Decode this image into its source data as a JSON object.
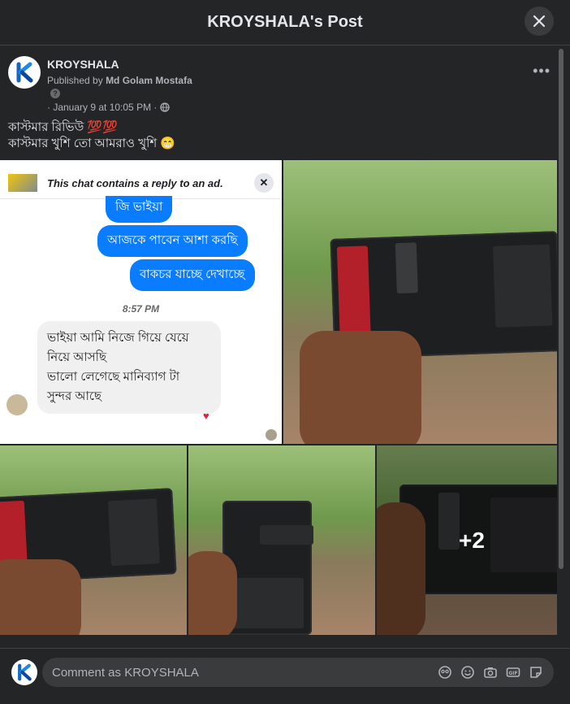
{
  "header": {
    "title": "KROYSHALA's Post"
  },
  "post": {
    "page_name": "KROYSHALA",
    "published_prefix": "Published by",
    "published_by": "Md Golam Mostafa",
    "date": "· January 9 at 10:05 PM ·",
    "caption_line1": "কাস্টমার রিভিউ 💯💯",
    "caption_line2": "কাস্টমার খুশি তো আমরাও খুশি 😁"
  },
  "chat_screenshot": {
    "banner_text": "This chat contains a reply to an ad.",
    "partial_bubble": "জি ভাইয়া",
    "msg_out_1": "আজকে পাবেন আশা করছি",
    "msg_out_2": "বাকচর যাচ্ছে দেখাচ্ছে",
    "time": "8:57 PM",
    "msg_in_line1": "ভাইয়া আমি নিজে গিয়ে যেয়ে",
    "msg_in_line2": "নিয়ে আসছি",
    "msg_in_line3": "ভালো লেগেছে মানিব্যাগ টা",
    "msg_in_line4": "সুন্দর আছে"
  },
  "photos": {
    "more_count": "+2"
  },
  "comment": {
    "placeholder": "Comment as KROYSHALA"
  },
  "colors": {
    "brand": "#1877f2",
    "bg": "#242526",
    "bubble_out": "#0a7cff"
  },
  "icons": [
    "close-icon",
    "more-options-icon",
    "globe-icon",
    "help-icon",
    "avatar-sticker-icon",
    "emoji-icon",
    "camera-icon",
    "gif-icon",
    "sticker-icon"
  ]
}
